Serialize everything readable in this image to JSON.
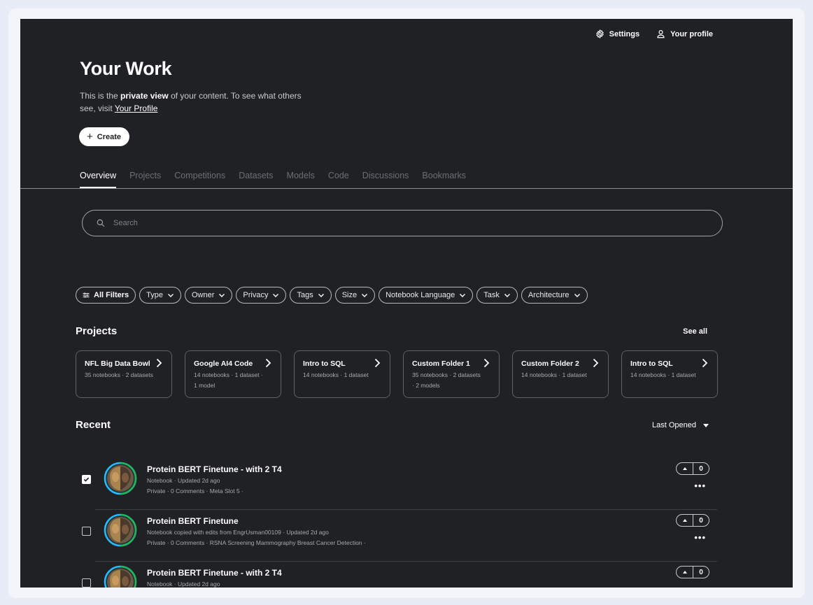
{
  "topbar": {
    "settings_label": "Settings",
    "profile_label": "Your profile"
  },
  "hero": {
    "title": "Your Work",
    "desc_pre": "This is the ",
    "desc_bold": "private view",
    "desc_mid": " of your content. To see what others see, visit ",
    "desc_link": "Your Profile",
    "create_label": "Create"
  },
  "tabs": [
    {
      "label": "Overview",
      "active": true
    },
    {
      "label": "Projects"
    },
    {
      "label": "Competitions"
    },
    {
      "label": "Datasets"
    },
    {
      "label": "Models"
    },
    {
      "label": "Code"
    },
    {
      "label": "Discussions"
    },
    {
      "label": "Bookmarks"
    }
  ],
  "search": {
    "placeholder": "Search"
  },
  "filters": {
    "all_label": "All Filters",
    "items": [
      "Type",
      "Owner",
      "Privacy",
      "Tags",
      "Size",
      "Notebook Language",
      "Task",
      "Architecture"
    ]
  },
  "projects": {
    "title": "Projects",
    "see_all": "See all",
    "items": [
      {
        "name": "NFL Big Data Bowl",
        "meta": "35 notebooks · 2 datasets"
      },
      {
        "name": "Google AI4 Code",
        "meta": "14 notebooks · 1 dataset · 1 model"
      },
      {
        "name": "Intro to SQL",
        "meta": "14 notebooks · 1 dataset"
      },
      {
        "name": "Custom Folder 1",
        "meta": "35 notebooks · 2 datasets · 2 models"
      },
      {
        "name": "Custom Folder 2",
        "meta": "14 notebooks · 1 dataset"
      },
      {
        "name": "Intro to SQL",
        "meta": "14 notebooks · 1 dataset"
      }
    ]
  },
  "recent": {
    "title": "Recent",
    "sort_label": "Last Opened",
    "items": [
      {
        "title": "Protein BERT Finetune - with 2 T4",
        "line1": "Notebook · Updated 2d ago",
        "line2": "Private · 0 Comments · Meta Slot 5 ·",
        "votes": "0",
        "checked": true
      },
      {
        "title": "Protein BERT Finetune",
        "line1": "Notebook copied with edits from EngrUsman00109 · Updated 2d ago",
        "line2": "Private · 0 Comments · RSNA Screening Mammography Breast Cancer Detection ·",
        "votes": "0",
        "checked": false
      },
      {
        "title": "Protein BERT Finetune - with 2 T4",
        "line1": "Notebook · Updated 2d ago",
        "line2": "",
        "votes": "0",
        "checked": false
      }
    ]
  },
  "colors": {
    "background": "#202124",
    "text": "#ffffff",
    "muted": "#a6a9ad",
    "avatar_ring_blue": "#20beff",
    "avatar_ring_green": "#1eb85c"
  },
  "icons": {
    "settings": "gear-icon",
    "profile": "user-icon",
    "create": "plus-icon",
    "search": "search-icon",
    "filters": "sliders-icon",
    "chip": "chevron-down-icon",
    "project": "chevron-right-icon",
    "sort": "caret-down-icon",
    "vote": "upvote-icon",
    "more": "more-horizontal-icon"
  }
}
